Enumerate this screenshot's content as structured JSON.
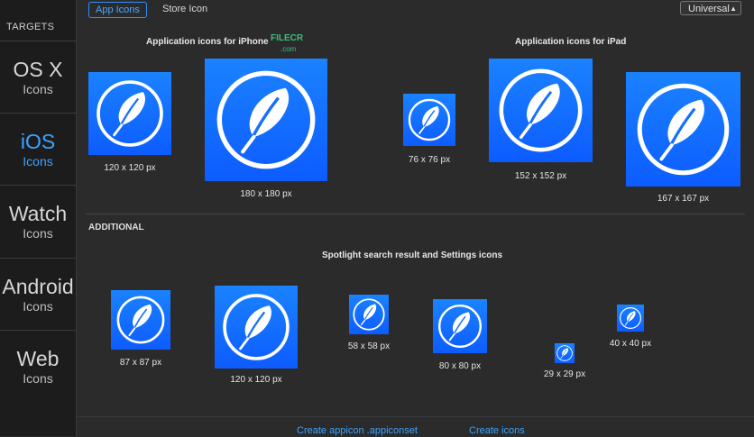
{
  "sidebar": {
    "title": "TARGETS",
    "items": [
      {
        "line1": "OS X",
        "line2": "Icons"
      },
      {
        "line1": "iOS",
        "line2": "Icons"
      },
      {
        "line1": "Watch",
        "line2": "Icons"
      },
      {
        "line1": "Android",
        "line2": "Icons"
      },
      {
        "line1": "Web",
        "line2": "Icons"
      }
    ]
  },
  "tabs": {
    "app_icons": "App Icons",
    "store_icon": "Store Icon"
  },
  "device_select": {
    "value": "Universal"
  },
  "sections": {
    "iphone_title": "Application icons for iPhone",
    "ipad_title": "Application icons for iPad",
    "additional_label": "ADDITIONAL",
    "spotlight_title": "Spotlight search result and Settings icons"
  },
  "watermark": {
    "line1": "FILECR",
    "line2": ".com"
  },
  "icons": {
    "iphone_120": "120 x 120 px",
    "iphone_180": "180 x 180 px",
    "ipad_76": "76 x 76 px",
    "ipad_152": "152 x 152 px",
    "ipad_167": "167 x 167 px",
    "add_87": "87 x 87 px",
    "add_120": "120 x 120 px",
    "add_58": "58 x 58 px",
    "add_80": "80 x 80 px",
    "add_29": "29 x 29 px",
    "add_40": "40 x 40 px"
  },
  "footer": {
    "create_appiconset": "Create appicon .appiconset",
    "create_icons": "Create icons"
  },
  "colors": {
    "accent": "#3aa3ff",
    "icon_blue": "#1470ff"
  }
}
